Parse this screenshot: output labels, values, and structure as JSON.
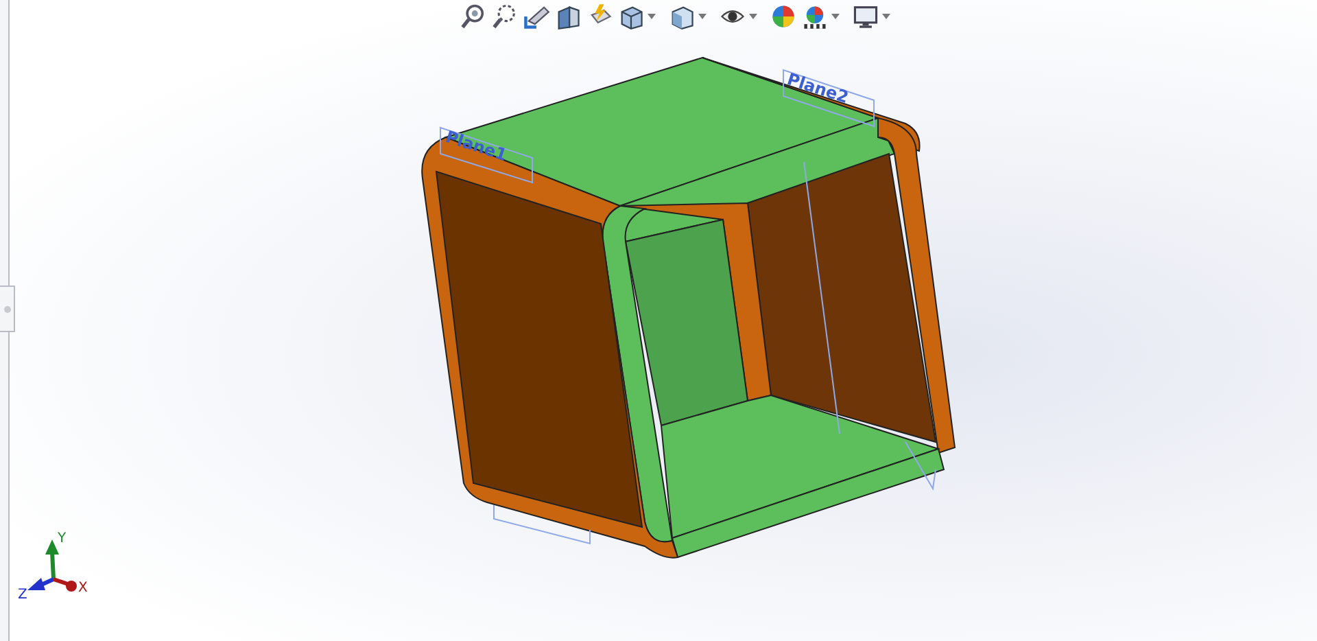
{
  "toolbar": {
    "items": [
      {
        "kind": "zoom-fit",
        "dropdown": false
      },
      {
        "kind": "zoom-area",
        "dropdown": false
      },
      {
        "kind": "previous-view",
        "dropdown": false
      },
      {
        "kind": "section-view",
        "dropdown": false
      },
      {
        "kind": "annotation",
        "dropdown": false
      },
      {
        "kind": "orientation",
        "dropdown": true
      },
      {
        "kind": "display-style",
        "dropdown": true
      },
      {
        "kind": "visibility",
        "dropdown": true
      },
      {
        "kind": "appearance",
        "dropdown": false
      },
      {
        "kind": "scene",
        "dropdown": true
      },
      {
        "kind": "view-settings",
        "dropdown": true
      }
    ]
  },
  "model": {
    "planes": [
      {
        "label": "Plane1"
      },
      {
        "label": "Plane2"
      }
    ]
  },
  "triad": {
    "axes": [
      {
        "kind": "y",
        "label": "Y"
      },
      {
        "kind": "z",
        "label": "Z"
      },
      {
        "kind": "x",
        "label": "X"
      }
    ]
  }
}
